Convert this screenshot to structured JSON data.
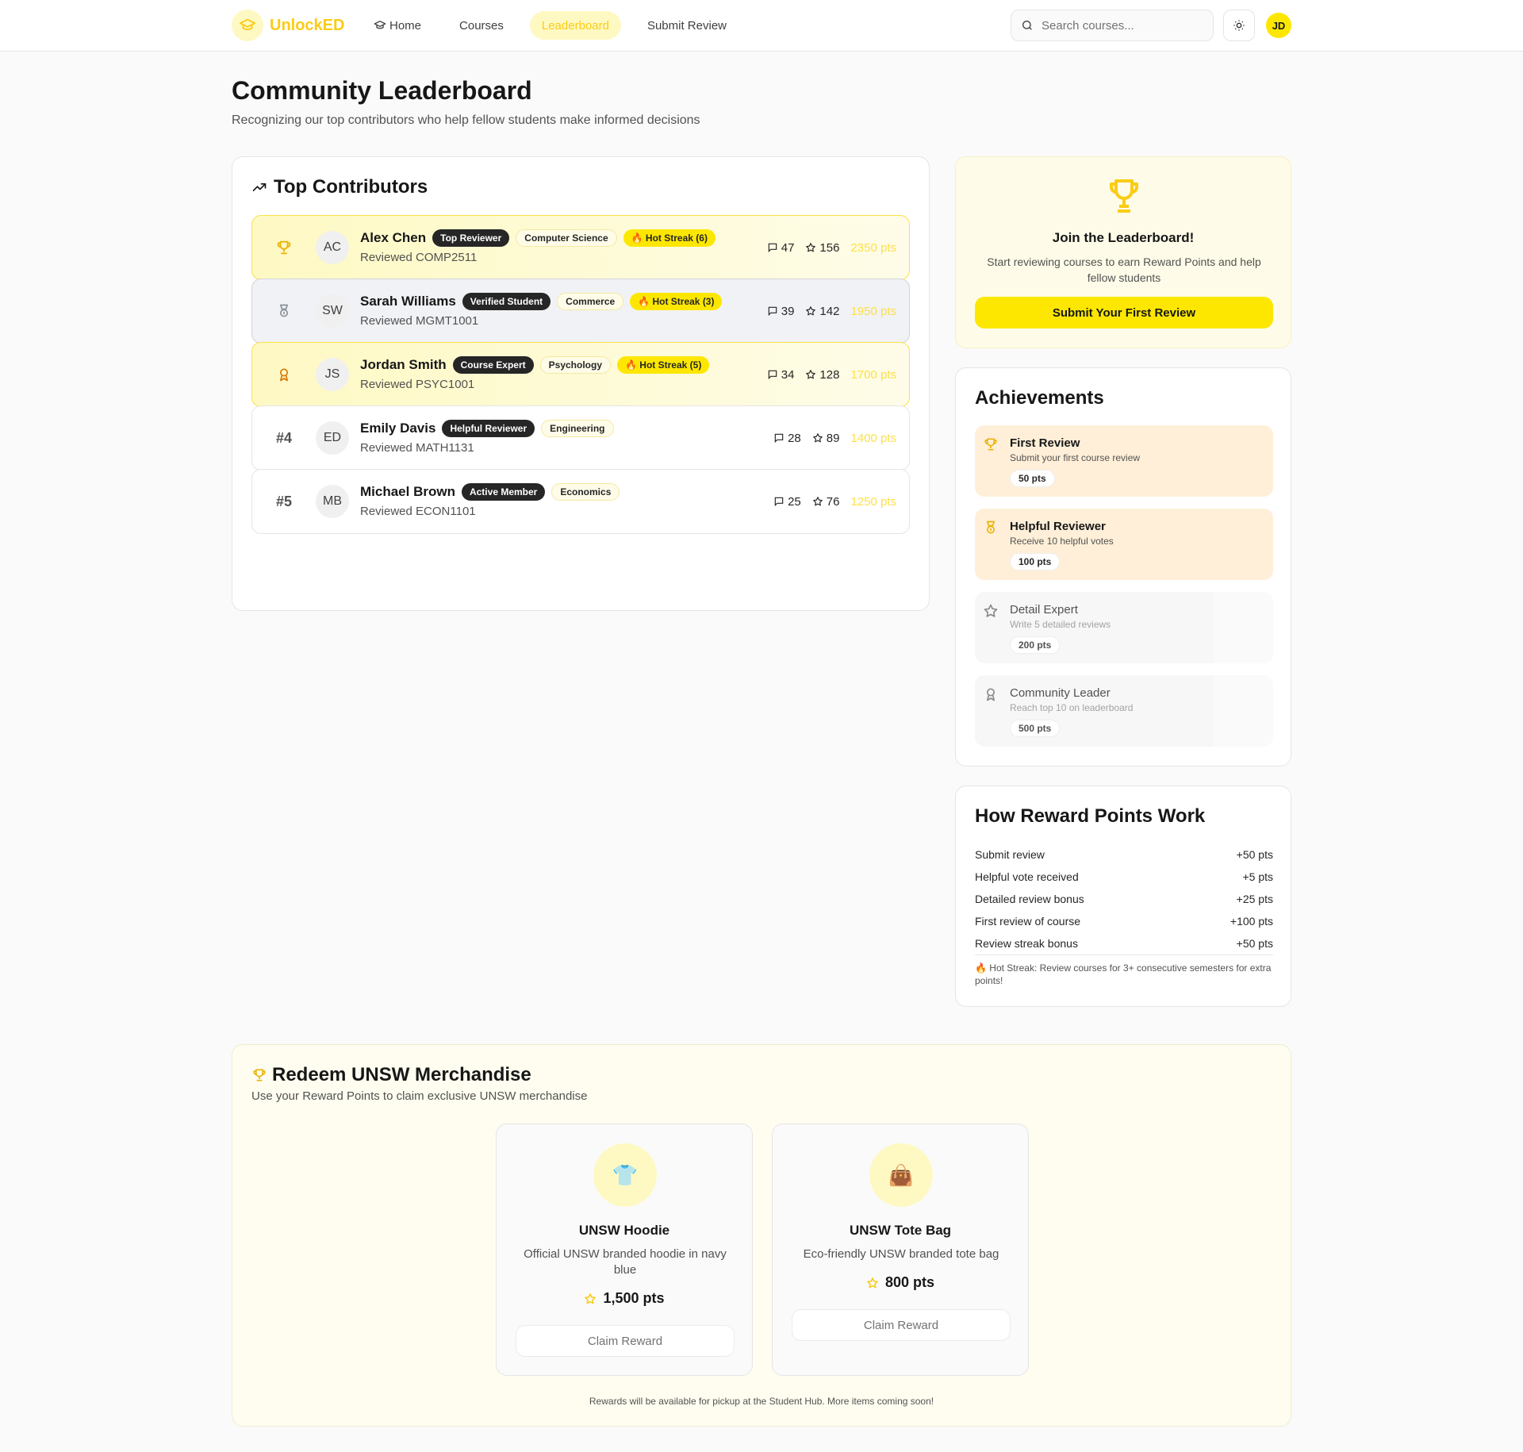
{
  "nav": {
    "brand": "UnlockED",
    "items": [
      "Home",
      "Courses",
      "Leaderboard",
      "Submit Review"
    ],
    "search_placeholder": "Search courses...",
    "user_initials": "JD",
    "accent_color": "#fde700"
  },
  "page": {
    "title": "Community Leaderboard",
    "subtitle": "Recognizing our top contributors who help fellow students make informed decisions"
  },
  "contributors": {
    "title": "Top Contributors",
    "rows": [
      {
        "rank": "",
        "initials": "AC",
        "name": "Alex Chen",
        "role": "Top Reviewer",
        "faculty": "Computer Science",
        "streak": "🔥 Hot Streak (6)",
        "course": "Reviewed COMP2511",
        "reviews": "47",
        "votes": "156",
        "points": "2350 pts"
      },
      {
        "rank": "",
        "initials": "SW",
        "name": "Sarah Williams",
        "role": "Verified Student",
        "faculty": "Commerce",
        "streak": "🔥 Hot Streak (3)",
        "course": "Reviewed MGMT1001",
        "reviews": "39",
        "votes": "142",
        "points": "1950 pts"
      },
      {
        "rank": "",
        "initials": "JS",
        "name": "Jordan Smith",
        "role": "Course Expert",
        "faculty": "Psychology",
        "streak": "🔥 Hot Streak (5)",
        "course": "Reviewed PSYC1001",
        "reviews": "34",
        "votes": "128",
        "points": "1700 pts"
      },
      {
        "rank": "#4",
        "initials": "ED",
        "name": "Emily Davis",
        "role": "Helpful Reviewer",
        "faculty": "Engineering",
        "streak": "",
        "course": "Reviewed MATH1131",
        "reviews": "28",
        "votes": "89",
        "points": "1400 pts"
      },
      {
        "rank": "#5",
        "initials": "MB",
        "name": "Michael Brown",
        "role": "Active Member",
        "faculty": "Economics",
        "streak": "",
        "course": "Reviewed ECON1101",
        "reviews": "25",
        "votes": "76",
        "points": "1250 pts"
      }
    ]
  },
  "join": {
    "title": "Join the Leaderboard!",
    "text": "Start reviewing courses to earn Reward Points and help fellow students",
    "button": "Submit Your First Review"
  },
  "achievements": {
    "title": "Achievements",
    "items": [
      {
        "name": "First Review",
        "desc": "Submit your first course review",
        "points": "50 pts",
        "icon": "trophy-icon",
        "unlocked": true
      },
      {
        "name": "Helpful Reviewer",
        "desc": "Receive 10 helpful votes",
        "points": "100 pts",
        "icon": "medal-icon",
        "unlocked": true
      },
      {
        "name": "Detail Expert",
        "desc": "Write 5 detailed reviews",
        "points": "200 pts",
        "icon": "star-icon",
        "unlocked": false
      },
      {
        "name": "Community Leader",
        "desc": "Reach top 10 on leaderboard",
        "points": "500 pts",
        "icon": "award-icon",
        "unlocked": false
      }
    ]
  },
  "reward_points": {
    "title": "How Reward Points Work",
    "rows": [
      {
        "label": "Submit review",
        "value": "+50 pts"
      },
      {
        "label": "Helpful vote received",
        "value": "+5 pts"
      },
      {
        "label": "Detailed review bonus",
        "value": "+25 pts"
      },
      {
        "label": "First review of course",
        "value": "+100 pts"
      },
      {
        "label": "Review streak bonus",
        "value": "+50 pts"
      }
    ],
    "note": "🔥 Hot Streak: Review courses for 3+ consecutive semesters for extra points!"
  },
  "merch": {
    "title": "Redeem UNSW Merchandise",
    "subtitle": "Use your Reward Points to claim exclusive UNSW merchandise",
    "products": [
      {
        "icon": "👕",
        "name": "UNSW Hoodie",
        "desc": "Official UNSW branded hoodie in navy blue",
        "price": "1,500 pts",
        "button": "Claim Reward"
      },
      {
        "icon": "👜",
        "name": "UNSW Tote Bag",
        "desc": "Eco-friendly UNSW branded tote bag",
        "price": "800 pts",
        "button": "Claim Reward"
      }
    ],
    "footer": "Rewards will be available for pickup at the Student Hub. More items coming soon!"
  }
}
